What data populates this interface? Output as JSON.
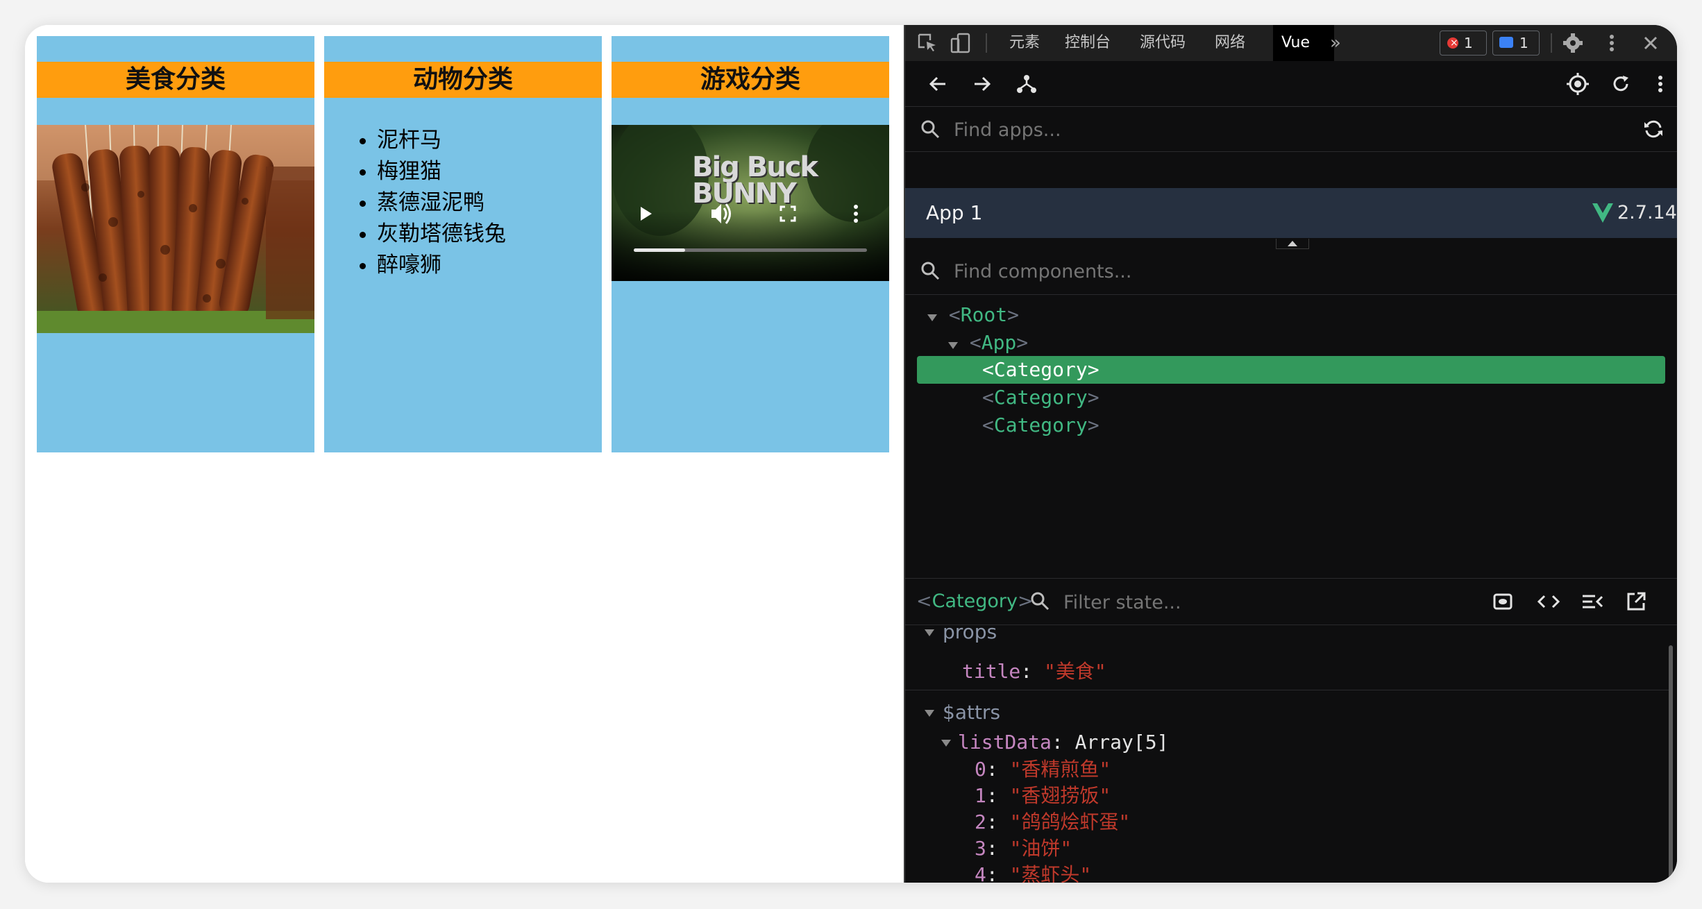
{
  "app_page": {
    "categories": [
      {
        "title": "美食分类",
        "kind": "image"
      },
      {
        "title": "动物分类",
        "kind": "list",
        "items": [
          "泥杆马",
          "梅狸猫",
          "蒸德湿泥鸭",
          "灰勒塔德钱兔",
          "醉嚎狮"
        ]
      },
      {
        "title": "游戏分类",
        "kind": "video",
        "video_title": "Big Buck BUNNY"
      }
    ]
  },
  "devtools": {
    "tabs": [
      "元素",
      "控制台",
      "源代码",
      "网络",
      "Vue"
    ],
    "active_tab": "Vue",
    "error_count": "1",
    "message_count": "1",
    "find_apps_placeholder": "Find apps...",
    "app_name": "App 1",
    "vue_version": "2.7.14",
    "find_components_placeholder": "Find components...",
    "tree": [
      {
        "name": "Root",
        "depth": 0,
        "expanded": true
      },
      {
        "name": "App",
        "depth": 1,
        "expanded": true
      },
      {
        "name": "Category",
        "depth": 2,
        "selected": true
      },
      {
        "name": "Category",
        "depth": 2
      },
      {
        "name": "Category",
        "depth": 2
      }
    ],
    "selected_component": "Category",
    "filter_state_placeholder": "Filter state...",
    "props_label": "props",
    "props": [
      {
        "key": "title",
        "value": "\"美食\""
      }
    ],
    "attrs_label": "$attrs",
    "list_key": "listData",
    "list_type": "Array[5]",
    "list_items": [
      {
        "index": "0",
        "value": "\"香精煎鱼\""
      },
      {
        "index": "1",
        "value": "\"香翅捞饭\""
      },
      {
        "index": "2",
        "value": "\"鸽鸽烩虾蛋\""
      },
      {
        "index": "3",
        "value": "\"油饼\""
      },
      {
        "index": "4",
        "value": "\"蒸虾头\""
      }
    ],
    "colors": {
      "vue_green": "#41b883",
      "selection": "#33995c",
      "string_red": "#c0392b"
    }
  }
}
